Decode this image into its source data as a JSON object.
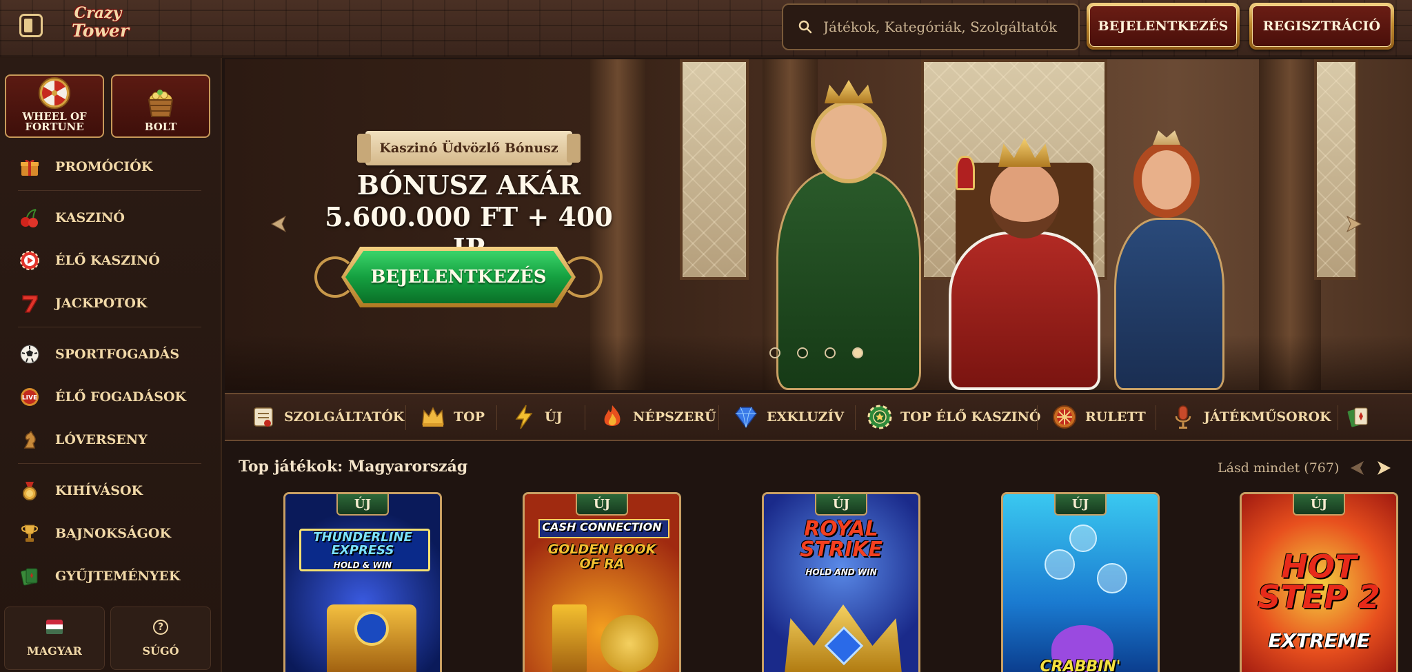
{
  "header": {
    "logo_line1": "Crazy",
    "logo_line2": "Tower",
    "search_placeholder": "Játékok, Kategóriák, Szolgáltatók",
    "login_label": "BEJELENTKEZÉS",
    "register_label": "REGISZTRÁCIÓ"
  },
  "sidebar": {
    "promo_tiles": [
      {
        "label": "WHEEL OF FORTUNE",
        "icon": "wheel-of-fortune-icon"
      },
      {
        "label": "BOLT",
        "icon": "coin-basket-icon"
      }
    ],
    "items": [
      {
        "label": "PROMÓCIÓK",
        "icon": "gift-icon"
      },
      {
        "label": "KASZINÓ",
        "icon": "cherries-icon"
      },
      {
        "label": "ÉLŐ KASZINÓ",
        "icon": "live-play-icon"
      },
      {
        "label": "JACKPOTOK",
        "icon": "lucky-seven-icon"
      },
      {
        "label": "SPORTFOGADÁS",
        "icon": "soccer-ball-icon"
      },
      {
        "label": "ÉLŐ FOGADÁSOK",
        "icon": "live-badge-icon"
      },
      {
        "label": "LÓVERSENY",
        "icon": "horse-icon"
      },
      {
        "label": "KIHÍVÁSOK",
        "icon": "medal-icon"
      },
      {
        "label": "BAJNOKSÁGOK",
        "icon": "trophy-icon"
      },
      {
        "label": "GYŰJTEMÉNYEK",
        "icon": "cards-icon"
      }
    ],
    "language_label": "MAGYAR",
    "help_label": "SÚGÓ",
    "flag_colors": [
      "#cd2a3e",
      "#ffffff",
      "#436f4d"
    ]
  },
  "hero": {
    "ribbon_text": "Kaszinó Üdvözlő Bónusz",
    "title_line1": "BÓNUSZ AKÁR",
    "title_line2": "5.600.000 FT + 400 IP",
    "cta_label": "BEJELENTKEZÉS",
    "slides_count": 4,
    "active_slide": 1
  },
  "categories": [
    {
      "label": "SZOLGÁLTATÓK",
      "icon": "scroll-icon"
    },
    {
      "label": "TOP",
      "icon": "crown-icon"
    },
    {
      "label": "ÚJ",
      "icon": "lightning-icon"
    },
    {
      "label": "NÉPSZERŰ",
      "icon": "flame-icon"
    },
    {
      "label": "EXKLUZÍV",
      "icon": "diamond-icon"
    },
    {
      "label": "TOP ÉLŐ KASZINÓ",
      "icon": "casino-chip-icon"
    },
    {
      "label": "RULETT",
      "icon": "roulette-icon"
    },
    {
      "label": "JÁTÉKMŰSOROK",
      "icon": "microphone-icon"
    },
    {
      "label": "",
      "icon": "card-icon"
    }
  ],
  "games_section": {
    "title": "Top játékok: Magyarország",
    "see_all": "Lásd mindet (767)",
    "games": [
      {
        "badge": "ÚJ",
        "title": "THUNDERLINE EXPRESS",
        "subtitle": "HOLD & WIN"
      },
      {
        "badge": "ÚJ",
        "title": "CASH CONNECTION",
        "subtitle": "GOLDEN BOOK OF RA"
      },
      {
        "badge": "ÚJ",
        "title": "ROYAL STRIKE",
        "subtitle": "HOLD AND WIN"
      },
      {
        "badge": "ÚJ",
        "title": "CRABBIN'",
        "subtitle": ""
      },
      {
        "badge": "ÚJ",
        "title": "HOT STEP 2",
        "subtitle": "EXTREME"
      }
    ]
  },
  "colors": {
    "accent_gold": "#e6c98c",
    "badge_green": "#2e6a3a",
    "cta_green": "#15a040",
    "button_red": "#6a1d14"
  }
}
